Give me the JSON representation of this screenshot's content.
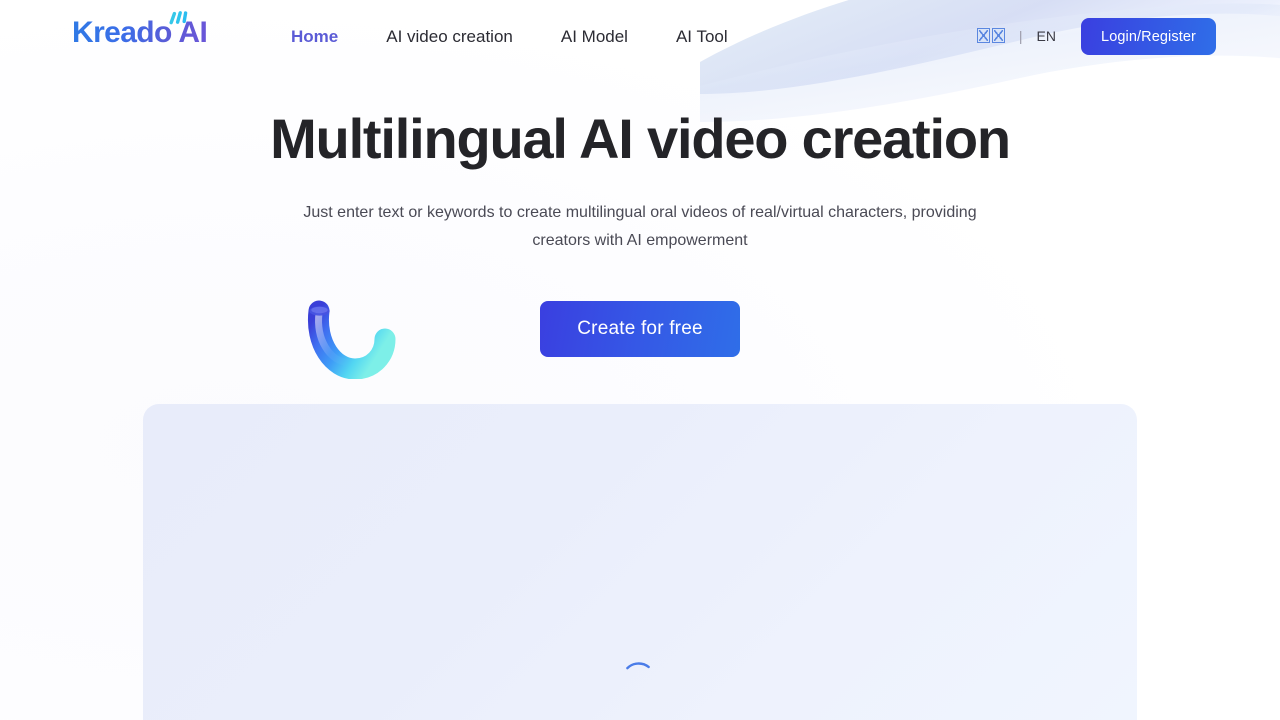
{
  "brand": {
    "name": "Kreado AI",
    "logo_icon": "kreado-logo-ticks",
    "gradient_start": "#2f7ae5",
    "gradient_end": "#6a56d8"
  },
  "header": {
    "nav": [
      {
        "label": "Home",
        "active": true
      },
      {
        "label": "AI video creation",
        "active": false
      },
      {
        "label": "AI Model",
        "active": false
      },
      {
        "label": "AI Tool",
        "active": false
      }
    ],
    "language": {
      "options": [
        {
          "label": "□□",
          "active": true,
          "tofu": true
        },
        {
          "label": "EN",
          "active": false,
          "tofu": false
        }
      ],
      "separator": "|"
    },
    "login_label": "Login/Register",
    "login_color": "#3a3fe0"
  },
  "hero": {
    "title": "Multilingual AI video creation",
    "subtitle": "Just enter text or keywords to create multilingual oral videos of real/virtual characters, providing creators with AI empowerment",
    "cta_label": "Create for free",
    "cta_color": "#3558e6",
    "decoration_icon": "curved-tube-icon"
  },
  "content_panel": {
    "state": "loading",
    "spinner_icon": "loading-spinner-icon",
    "spinner_color": "#4a7ce8",
    "background_color": "#eaeefb"
  }
}
